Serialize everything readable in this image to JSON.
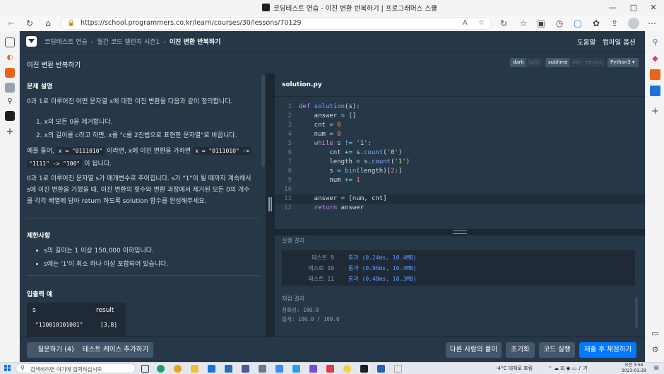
{
  "window": {
    "title": "코딩테스트 연습 - 이진 변환 반복하기 | 프로그래머스 스쿨",
    "controls": [
      "—",
      "□",
      "✕"
    ]
  },
  "browser": {
    "url": "https://school.programmers.co.kr/learn/courses/30/lessons/70129"
  },
  "header": {
    "breadcrumbs": [
      "코딩테스트 연습",
      "월간 코드 챌린지 시즌1",
      "이진 변환 반복하기"
    ],
    "help": "도움말",
    "compile_options": "컴파일 옵션"
  },
  "lesson_bar": {
    "title": "이진 변환 반복하기",
    "theme_options": [
      "dark",
      "light"
    ],
    "keymap_options": [
      "sublime",
      "vim",
      "emacs"
    ],
    "language": "Python3"
  },
  "description": {
    "section_problem": "문제 설명",
    "intro": "0과 1로 이루어진 어떤 문자열 x에 대한 이진 변환을 다음과 같이 정의합니다.",
    "rules": [
      "1. x의 모든 0을 제거합니다.",
      "2. x의 길이를 c라고 하면, x를 \"c를 2진법으로 표현한 문자열\"로 바꿉니다."
    ],
    "example_prefix": "예를 들어,",
    "example_code1": "x = \"0111010\"",
    "example_mid": "이라면, x에 이진 변환을 가하면",
    "example_code2": "x = \"0111010\" ->",
    "example_code3": "\"1111\" -> \"100\"",
    "example_suffix": "이 됩니다.",
    "task_line1": "0과 1로 이루어진 문자열 s가 매개변수로 주어집니다. s가 \"1\"이 될 때까지 계속해서",
    "task_line2": "s에 이진 변환을 가했을 때, 이진 변환의 횟수와 변환 과정에서 제거된 모든 0의 개수",
    "task_line3": "를 각각 배열에 담아 return 하도록 solution 함수를 완성해주세요.",
    "section_limits": "제한사항",
    "limits": [
      "s의 길이는 1 이상 150,000 이하입니다.",
      "s에는 '1'이 최소 하나 이상 포함되어 있습니다."
    ],
    "section_io": "입출력 예",
    "io_headers": [
      "s",
      "result"
    ],
    "io_rows": [
      [
        "\"110010101001\"",
        "[3,8]"
      ]
    ]
  },
  "editor": {
    "filename": "solution.py",
    "lines": [
      "def solution(s):",
      "    answer = []",
      "    cnt = 0",
      "    num = 0",
      "    while s != '1':",
      "        cnt += s.count('0')",
      "        length = s.count('1')",
      "        s = bin(length)[2:]",
      "        num += 1",
      "",
      "    answer = [num, cnt]",
      "    return answer"
    ]
  },
  "results": {
    "label": "실행 결과",
    "rows": [
      {
        "name": "테스트 9",
        "value": "통과 (0.24ms, 10.4MB)"
      },
      {
        "name": "테스트 10",
        "value": "통과 (0.96ms, 10.4MB)"
      },
      {
        "name": "테스트 11",
        "value": "통과 (0.48ms, 10.3MB)"
      }
    ],
    "final_label": "채점 결과",
    "accuracy": "정확성: 100.0",
    "total": "합계: 100.0 / 100.0"
  },
  "buttons": {
    "ask": "질문하기 (4)",
    "add_testcase": "테스트 케이스 추가하기",
    "others_solutions": "다른 사람의 풀이",
    "reset": "초기화",
    "run": "코드 실행",
    "submit": "제출 후 채점하기"
  },
  "taskbar": {
    "search_placeholder": "검색하려면 여기에 입력하십시오",
    "weather": "-4°C 대체로 흐림",
    "time": "오전 3:56",
    "date": "2023-01-29"
  },
  "colors": {
    "panel": "#263747",
    "primary": "#0078ff",
    "pass_text": "#5c9dff"
  }
}
